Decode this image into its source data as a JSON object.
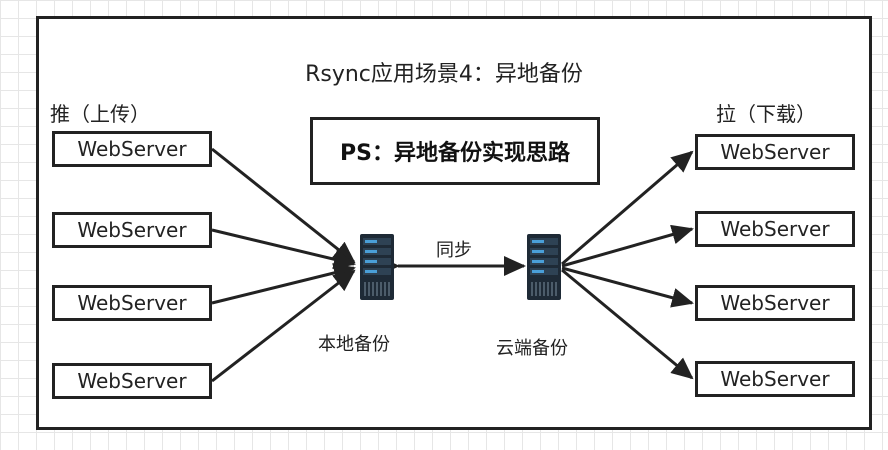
{
  "title": "Rsync应用场景4：异地备份",
  "push_label": "推（上传）",
  "pull_label": "拉（下载）",
  "ps_text": "PS：异地备份实现思路",
  "left_servers": [
    "WebServer",
    "WebServer",
    "WebServer",
    "WebServer"
  ],
  "right_servers": [
    "WebServer",
    "WebServer",
    "WebServer",
    "WebServer"
  ],
  "local_backup_label": "本地备份",
  "cloud_backup_label": "云端备份",
  "sync_label": "同步",
  "colors": {
    "line": "#222222",
    "server_dark": "#1e2a36",
    "server_accent": "#4a9fd8"
  },
  "icons": {
    "local_server": "server-rack-icon",
    "cloud_server": "server-rack-icon"
  }
}
